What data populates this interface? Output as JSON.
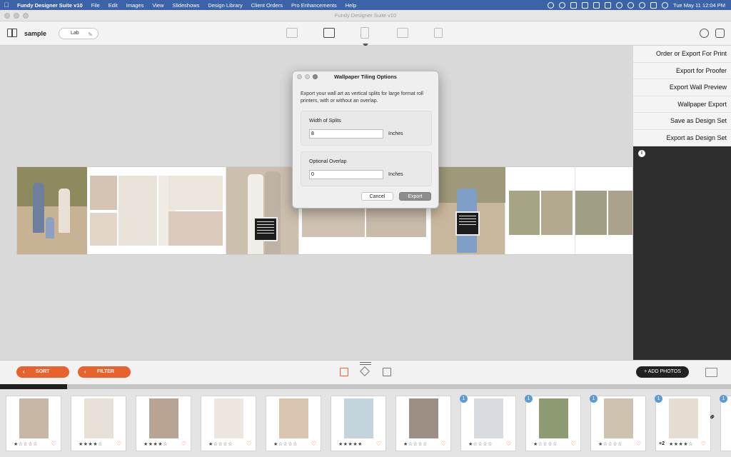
{
  "menubar": {
    "app_name": "Fundy Designer Suite v10",
    "items": [
      "File",
      "Edit",
      "Images",
      "View",
      "Slideshows",
      "Design Library",
      "Client Orders",
      "Pro Enhancements",
      "Help"
    ],
    "clock": "Tue May 11  12:04 PM"
  },
  "window": {
    "title": "Fundy Designer Suite v10"
  },
  "toolbar": {
    "project_name": "sample",
    "lab_label": "Lab",
    "mode_icons": [
      "import-icon",
      "album-icon",
      "wall-art-icon",
      "card-icon",
      "proofing-icon"
    ],
    "active_mode": "wall-art-icon"
  },
  "right_panel": {
    "items": [
      "Order or Export For Print",
      "Export for Proofer",
      "Export Wall Preview",
      "Wallpaper Export",
      "Save as Design Set",
      "Export as Design Set"
    ]
  },
  "dialog": {
    "title": "Wallpaper Tiling Options",
    "description": "Export your wall art as vertical splits for large format roll printers, with or without an overlap.",
    "width_label": "Width of Splits",
    "width_value": "8",
    "width_unit": "Inches",
    "overlap_label": "Optional Overlap",
    "overlap_value": "0",
    "overlap_unit": "Inches",
    "cancel_label": "Cancel",
    "export_label": "Export"
  },
  "bottombar": {
    "sort_label": "SORT",
    "filter_label": "FILTER",
    "add_photos_label": "+ ADD PHOTOS"
  },
  "filmstrip": {
    "scroll_progress": 0.092,
    "thumbnails": [
      {
        "rating": 1,
        "badge": "",
        "extra": "",
        "color": "#c9b7a5"
      },
      {
        "rating": 4,
        "badge": "",
        "extra": "",
        "color": "#e8e0d6"
      },
      {
        "rating": 4,
        "badge": "",
        "extra": "",
        "color": "#b9a494"
      },
      {
        "rating": 1,
        "badge": "",
        "extra": "",
        "color": "#ece6df"
      },
      {
        "rating": 1,
        "badge": "",
        "extra": "",
        "color": "#d9c4b0"
      },
      {
        "rating": 5,
        "badge": "",
        "extra": "",
        "color": "#c4d4dc"
      },
      {
        "rating": 1,
        "badge": "",
        "extra": "",
        "color": "#9d8f84"
      },
      {
        "rating": 1,
        "badge": "1",
        "extra": "",
        "color": "#d8dbe0"
      },
      {
        "rating": 1,
        "badge": "1",
        "extra": "",
        "color": "#8e9a72"
      },
      {
        "rating": 1,
        "badge": "1",
        "extra": "",
        "color": "#cfc2ae"
      },
      {
        "rating": 4,
        "badge": "1",
        "extra": "+2",
        "color": "#e6ddd2"
      }
    ]
  },
  "colors": {
    "menubar": "#3c63a8",
    "accent": "#e8622d",
    "badge": "#5b9bd5",
    "right_panel": "#2d2d2d"
  }
}
